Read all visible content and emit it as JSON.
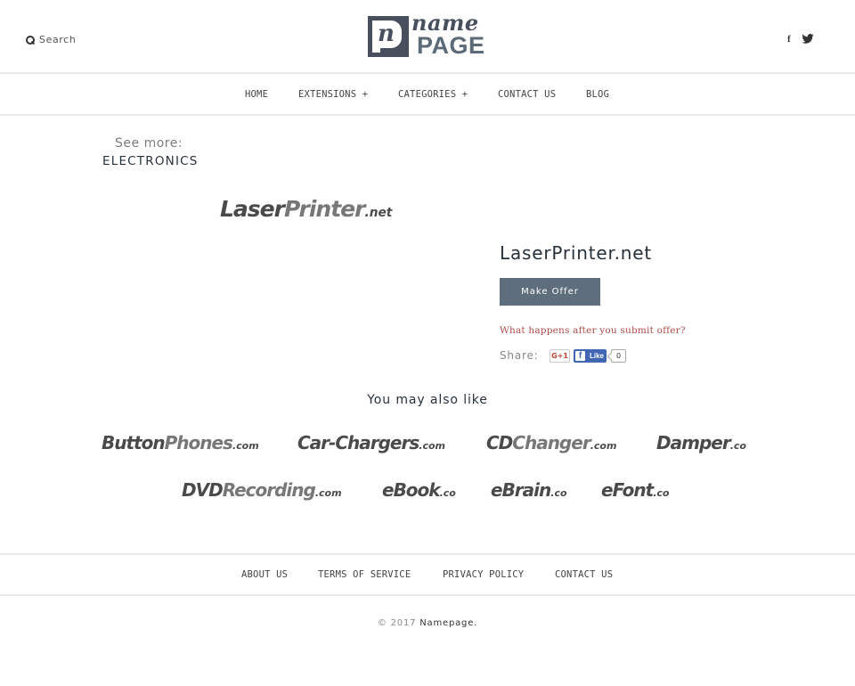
{
  "header": {
    "search_label": "Search",
    "logo": {
      "line1": "name",
      "line2": "PAGE",
      "monogram": "n"
    },
    "social": {
      "facebook": "f",
      "twitter": "twitter"
    }
  },
  "nav": {
    "items": [
      {
        "label": "HOME"
      },
      {
        "label": "EXTENSIONS +"
      },
      {
        "label": "CATEGORIES +"
      },
      {
        "label": "CONTACT US"
      },
      {
        "label": "BLOG"
      }
    ]
  },
  "category": {
    "see_more": "See more:",
    "name": "ELECTRONICS"
  },
  "listing": {
    "logo": {
      "part1": "Laser",
      "part2": "Printer",
      "tld": ".net"
    },
    "title": "LaserPrinter.net",
    "make_offer_label": "Make Offer",
    "offer_info_link": "What happens after you submit offer?",
    "share_label": "Share:",
    "gplus_label": "G+1",
    "fb_like_label": "Like",
    "fb_like_count": "0"
  },
  "recommendations": {
    "heading": "You may also like",
    "items": [
      {
        "part1": "Button",
        "part2": "Phones",
        "tld": ".com"
      },
      {
        "part1": "Car-Chargers",
        "part2": "",
        "tld": ".com"
      },
      {
        "part1": "CD",
        "part2": "Changer",
        "tld": ".com"
      },
      {
        "part1": "Damper",
        "part2": "",
        "tld": ".co"
      },
      {
        "part1": "DVD",
        "part2": "Recording",
        "tld": ".com"
      },
      {
        "part1": "eBook",
        "part2": "",
        "tld": ".co"
      },
      {
        "part1": "eBrain",
        "part2": "",
        "tld": ".co"
      },
      {
        "part1": "eFont",
        "part2": "",
        "tld": ".co"
      }
    ]
  },
  "footer": {
    "links": [
      {
        "label": "ABOUT US"
      },
      {
        "label": "TERMS OF SERVICE"
      },
      {
        "label": "PRIVACY POLICY"
      },
      {
        "label": "CONTACT US"
      }
    ],
    "copyright_year": "© 2017",
    "copyright_brand": "Namepage."
  },
  "colors": {
    "button": "#5f6e7d",
    "link": "#b04a4a",
    "facebook": "#4267b2",
    "logo": "#47505c"
  }
}
